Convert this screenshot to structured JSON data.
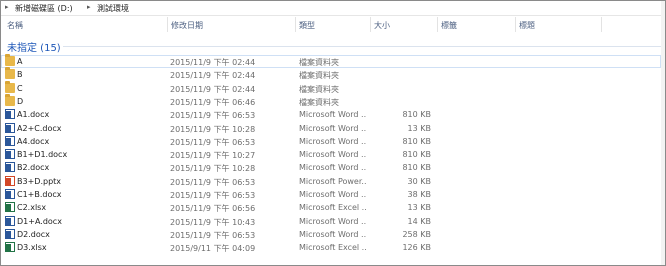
{
  "address_bar": {
    "segments": [
      "新增磁碟區 (D:)",
      "測試環境"
    ]
  },
  "columns": {
    "name": "名稱",
    "date": "修改日期",
    "type": "類型",
    "size": "大小",
    "tags": "標籤",
    "title": "標題"
  },
  "group": {
    "label": "未指定 (15)"
  },
  "files": [
    {
      "name": "A",
      "date": "2015/11/9 下午 02:44",
      "type": "檔案資料夾",
      "size": "",
      "icon": "folder-icon"
    },
    {
      "name": "B",
      "date": "2015/11/9 下午 02:44",
      "type": "檔案資料夾",
      "size": "",
      "icon": "folder-icon"
    },
    {
      "name": "C",
      "date": "2015/11/9 下午 02:44",
      "type": "檔案資料夾",
      "size": "",
      "icon": "folder-icon"
    },
    {
      "name": "D",
      "date": "2015/11/9 下午 06:46",
      "type": "檔案資料夾",
      "size": "",
      "icon": "folder-icon"
    },
    {
      "name": "A1.docx",
      "date": "2015/11/9 下午 06:53",
      "type": "Microsoft Word ...",
      "size": "810 KB",
      "icon": "word-icon"
    },
    {
      "name": "A2+C.docx",
      "date": "2015/11/9 下午 10:28",
      "type": "Microsoft Word ...",
      "size": "13 KB",
      "icon": "word-icon"
    },
    {
      "name": "A4.docx",
      "date": "2015/11/9 下午 06:53",
      "type": "Microsoft Word ...",
      "size": "810 KB",
      "icon": "word-icon"
    },
    {
      "name": "B1+D1.docx",
      "date": "2015/11/9 下午 10:27",
      "type": "Microsoft Word ...",
      "size": "810 KB",
      "icon": "word-icon"
    },
    {
      "name": "B2.docx",
      "date": "2015/11/9 下午 10:28",
      "type": "Microsoft Word ...",
      "size": "810 KB",
      "icon": "word-icon"
    },
    {
      "name": "B3+D.pptx",
      "date": "2015/11/9 下午 06:53",
      "type": "Microsoft Power...",
      "size": "30 KB",
      "icon": "powerpoint-icon"
    },
    {
      "name": "C1+B.docx",
      "date": "2015/11/9 下午 06:53",
      "type": "Microsoft Word ...",
      "size": "38 KB",
      "icon": "word-icon"
    },
    {
      "name": "C2.xlsx",
      "date": "2015/11/9 下午 06:56",
      "type": "Microsoft Excel ...",
      "size": "13 KB",
      "icon": "excel-icon"
    },
    {
      "name": "D1+A.docx",
      "date": "2015/11/9 下午 10:43",
      "type": "Microsoft Word ...",
      "size": "14 KB",
      "icon": "word-icon"
    },
    {
      "name": "D2.docx",
      "date": "2015/11/9 下午 06:53",
      "type": "Microsoft Word ...",
      "size": "258 KB",
      "icon": "word-icon"
    },
    {
      "name": "D3.xlsx",
      "date": "2015/9/11 下午 04:09",
      "type": "Microsoft Excel ...",
      "size": "126 KB",
      "icon": "excel-icon"
    }
  ]
}
